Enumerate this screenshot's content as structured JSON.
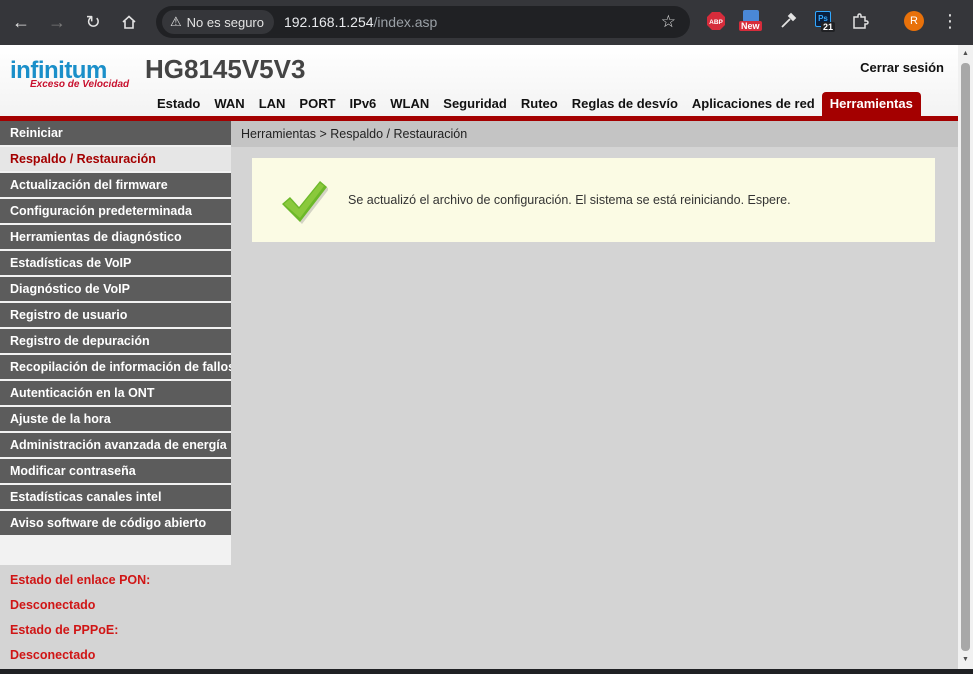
{
  "browser": {
    "security_label": "No es seguro",
    "url_host": "192.168.1.254",
    "url_path": "/index.asp",
    "ext_abp": "ABP",
    "ext_new": "New",
    "ext_ps_count": "21",
    "profile_initial": "R"
  },
  "header": {
    "brand": "infinitum",
    "tagline": "Exceso de Velocidad",
    "model": "HG8145V5V3",
    "logout": "Cerrar sesión",
    "tabs": [
      {
        "label": "Estado"
      },
      {
        "label": "WAN"
      },
      {
        "label": "LAN"
      },
      {
        "label": "PORT"
      },
      {
        "label": "IPv6"
      },
      {
        "label": "WLAN"
      },
      {
        "label": "Seguridad"
      },
      {
        "label": "Ruteo"
      },
      {
        "label": "Reglas de desvío"
      },
      {
        "label": "Aplicaciones de red"
      },
      {
        "label": "Herramientas"
      }
    ]
  },
  "sidebar": {
    "items": [
      {
        "label": "Reiniciar"
      },
      {
        "label": "Respaldo / Restauración"
      },
      {
        "label": "Actualización del firmware"
      },
      {
        "label": "Configuración predeterminada"
      },
      {
        "label": "Herramientas de diagnóstico"
      },
      {
        "label": "Estadísticas de VoIP"
      },
      {
        "label": "Diagnóstico de VoIP"
      },
      {
        "label": "Registro de usuario"
      },
      {
        "label": "Registro de depuración"
      },
      {
        "label": "Recopilación de información de fallos"
      },
      {
        "label": "Autenticación en la ONT"
      },
      {
        "label": "Ajuste de la hora"
      },
      {
        "label": "Administración avanzada de energía"
      },
      {
        "label": "Modificar contraseña"
      },
      {
        "label": "Estadísticas canales intel"
      },
      {
        "label": "Aviso software de código abierto"
      }
    ],
    "status": {
      "pon_label": "Estado del enlace PON:",
      "pon_value": "Desconectado",
      "pppoe_label": "Estado de PPPoE:",
      "pppoe_value": "Desconectado"
    }
  },
  "main": {
    "breadcrumb": "Herramientas > Respaldo / Restauración",
    "message": "Se actualizó el archivo de configuración. El sistema se está reiniciando. Espere."
  },
  "colors": {
    "accent": "#a40000",
    "menu_bg": "#5c5c5c",
    "status_text": "#d01515",
    "message_bg": "#fbfbe4",
    "check_green": "#6cb829"
  }
}
